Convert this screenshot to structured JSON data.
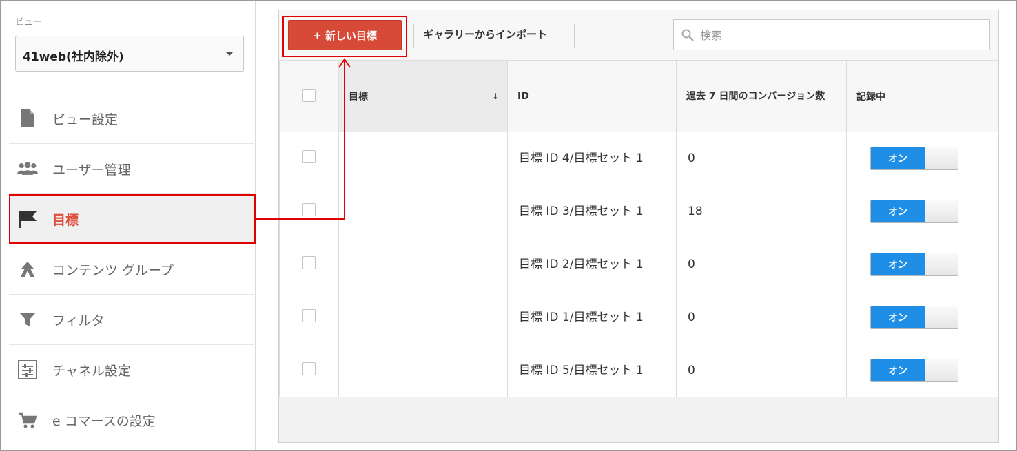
{
  "sidebar": {
    "view_label": "ビュー",
    "view_select_value": "41web(社内除外)",
    "items": [
      {
        "label": "ビュー設定",
        "icon": "document-icon"
      },
      {
        "label": "ユーザー管理",
        "icon": "users-icon"
      },
      {
        "label": "目標",
        "icon": "flag-icon"
      },
      {
        "label": "コンテンツ グループ",
        "icon": "content-group-icon"
      },
      {
        "label": "フィルタ",
        "icon": "filter-icon"
      },
      {
        "label": "チャネル設定",
        "icon": "channel-icon"
      },
      {
        "label": "e コマースの設定",
        "icon": "cart-icon"
      }
    ],
    "active_index": 2
  },
  "toolbar": {
    "new_goal_label": "+ 新しい目標",
    "import_label": "ギャラリーからインポート",
    "search_placeholder": "検索"
  },
  "table": {
    "headers": {
      "goal": "目標",
      "id": "ID",
      "conversions": "過去 7 日間のコンバージョン数",
      "recording": "記録中"
    },
    "rows": [
      {
        "goal": "",
        "id": "目標 ID 4/目標セット 1",
        "conversions": "0",
        "recording": "オン"
      },
      {
        "goal": "",
        "id": "目標 ID 3/目標セット 1",
        "conversions": "18",
        "recording": "オン"
      },
      {
        "goal": "",
        "id": "目標 ID 2/目標セット 1",
        "conversions": "0",
        "recording": "オン"
      },
      {
        "goal": "",
        "id": "目標 ID 1/目標セット 1",
        "conversions": "0",
        "recording": "オン"
      },
      {
        "goal": "",
        "id": "目標 ID 5/目標セット 1",
        "conversions": "0",
        "recording": "オン"
      }
    ]
  },
  "colors": {
    "accent_red": "#dd4b39",
    "highlight_red": "#e30000",
    "toggle_blue": "#1e8ee6"
  }
}
